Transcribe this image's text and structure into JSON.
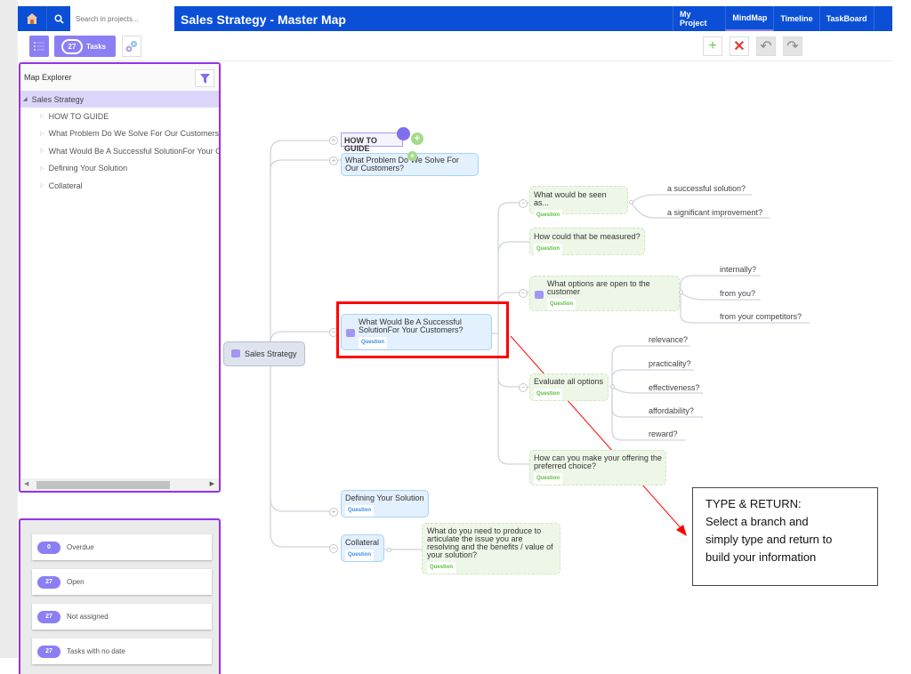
{
  "topbar": {
    "search_placeholder": "Search in projects...",
    "project_title": "Sales Strategy - Master Map",
    "nav_tabs": [
      {
        "label": "My Project",
        "active": false
      },
      {
        "label": "MindMap",
        "active": true
      },
      {
        "label": "Timeline",
        "active": false
      },
      {
        "label": "TaskBoard",
        "active": false
      }
    ],
    "brand_color": "#0a4fd6"
  },
  "toolbar": {
    "tasks_count": "27",
    "tasks_label": "Tasks",
    "add_icon": "+",
    "delete_icon": "✕",
    "undo_icon": "↶",
    "redo_icon": "↷"
  },
  "explorer": {
    "title": "Map Explorer",
    "root": "Sales Strategy",
    "items": [
      "HOW TO GUIDE",
      "What Problem Do We Solve For Our Customers?",
      "What Would Be A Successful SolutionFor Your Customers?",
      "Defining Your Solution",
      "Collateral"
    ]
  },
  "task_summary": [
    {
      "count": "0",
      "label": "Overdue"
    },
    {
      "count": "27",
      "label": "Open"
    },
    {
      "count": "27",
      "label": "Not assigned"
    },
    {
      "count": "27",
      "label": "Tasks with no date"
    }
  ],
  "mindmap": {
    "root": "Sales Strategy",
    "tag_label": "Question",
    "branches": {
      "guide": "HOW TO GUIDE",
      "problem": "What Problem Do We Solve For Our Customers?",
      "successful": "What Would Be A Successful SolutionFor Your Customers?",
      "defining": "Defining Your Solution",
      "collateral": "Collateral"
    },
    "sub": {
      "seen_as": "What would be seen as...",
      "measured": "How could that be measured?",
      "options": "What options are open to the customer",
      "evaluate": "Evaluate all options",
      "preferred": "How can you make your offering the preferred choice?",
      "produce": "What do you need to produce to articulate the issue you are resolving and the benefits / value of your solution?"
    },
    "leaves": {
      "seen_as": [
        "a successful solution?",
        "a significant improvement?"
      ],
      "options": [
        "internally?",
        "from you?",
        "from your competitors?"
      ],
      "evaluate": [
        "relevance?",
        "practicality?",
        "effectiveness?",
        "affordability?",
        "reward?"
      ]
    }
  },
  "callout": {
    "title": "TYPE & RETURN:",
    "lines": [
      "Select a branch and",
      "simply type and return to",
      "build your information"
    ]
  }
}
